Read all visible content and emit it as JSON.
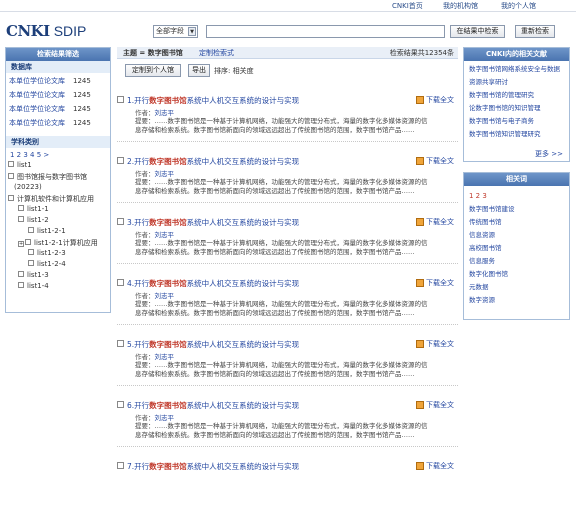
{
  "topnav": {
    "home": "CNKI首页",
    "org": "我的机构馆",
    "personal": "我的个人馆"
  },
  "logo": {
    "brand": "CNKI",
    "product": "SDIP"
  },
  "search": {
    "field": "全部字段",
    "query": "",
    "btn_in": "在结果中检索",
    "btn_re": "重新检索"
  },
  "left": {
    "title": "检索结果筛选",
    "db_head": "数据库",
    "dbs": [
      {
        "name": "本单位学位论文库",
        "count": "1245"
      },
      {
        "name": "本单位学位论文库",
        "count": "1245"
      },
      {
        "name": "本单位学位论文库",
        "count": "1245"
      },
      {
        "name": "本单位学位论文库",
        "count": "1245"
      }
    ],
    "cat_head": "学科类别",
    "pages": "1 2 3 4 5 >",
    "tree": [
      "list1",
      "图书馆报与数字图书馆",
      "(20223)",
      "计算机软件和计算机应用",
      "list1-1",
      "list1-2",
      "list1-2-1",
      "list1-2-1计算机应用",
      "list1-2-3",
      "list1-2-4",
      "list1-3",
      "list1-4"
    ]
  },
  "main": {
    "theme_label": "主题 = ",
    "theme_value": "数字图书馆",
    "custom": "定制检索式",
    "count_text": "检索结果共12354条",
    "btn_custom": "定制到个人馆",
    "btn_export": "导出",
    "sort": "排序: 相关度",
    "results": [
      {
        "num": "1.",
        "pre": "开行",
        "hl": "数字图书馆",
        "post": "系统中人机交互系统的设计与实现",
        "dl": "下载全文",
        "author_label": "作者：",
        "author": "刘志平",
        "abs1": "提要：……数字图书馆是一种基于计算机网络，功能强大的管理分布式，海量的数字化多媒体资源的信",
        "abs2": "息存储和检索系统。数字图书馆新面向的领域远远超出了传统图书馆的范围，数字图书馆产品……"
      },
      {
        "num": "2.",
        "pre": "开行",
        "hl": "数字图书馆",
        "post": "系统中人机交互系统的设计与实现",
        "dl": "下载全文",
        "author_label": "作者：",
        "author": "刘志平",
        "abs1": "提要：……数字图书馆是一种基于计算机网络，功能强大的管理分布式，海量的数字化多媒体资源的信",
        "abs2": "息存储和检索系统。数字图书馆新面向的领域远远超出了传统图书馆的范围，数字图书馆产品……"
      },
      {
        "num": "3.",
        "pre": "开行",
        "hl": "数字图书馆",
        "post": "系统中人机交互系统的设计与实现",
        "dl": "下载全文",
        "author_label": "作者：",
        "author": "刘志平",
        "abs1": "提要：……数字图书馆是一种基于计算机网络，功能强大的管理分布式，海量的数字化多媒体资源的信",
        "abs2": "息存储和检索系统。数字图书馆新面向的领域远远超出了传统图书馆的范围，数字图书馆产品……"
      },
      {
        "num": "4.",
        "pre": "开行",
        "hl": "数字图书馆",
        "post": "系统中人机交互系统的设计与实现",
        "dl": "下载全文",
        "author_label": "作者：",
        "author": "刘志平",
        "abs1": "提要：……数字图书馆是一种基于计算机网络，功能强大的管理分布式，海量的数字化多媒体资源的信",
        "abs2": "息存储和检索系统。数字图书馆新面向的领域远远超出了传统图书馆的范围，数字图书馆产品……"
      },
      {
        "num": "5.",
        "pre": "开行",
        "hl": "数字图书馆",
        "post": "系统中人机交互系统的设计与实现",
        "dl": "下载全文",
        "author_label": "作者：",
        "author": "刘志平",
        "abs1": "提要：……数字图书馆是一种基于计算机网络，功能强大的管理分布式，海量的数字化多媒体资源的信",
        "abs2": "息存储和检索系统。数字图书馆新面向的领域远远超出了传统图书馆的范围，数字图书馆产品……"
      },
      {
        "num": "6.",
        "pre": "开行",
        "hl": "数字图书馆",
        "post": "系统中人机交互系统的设计与实现",
        "dl": "下载全文",
        "author_label": "作者：",
        "author": "刘志平",
        "abs1": "提要：……数字图书馆是一种基于计算机网络，功能强大的管理分布式，海量的数字化多媒体资源的信",
        "abs2": "息存储和检索系统。数字图书馆新面向的领域远远超出了传统图书馆的范围，数字图书馆产品……"
      },
      {
        "num": "7.",
        "pre": "开行",
        "hl": "数字图书馆",
        "post": "系统中人机交互系统的设计与实现",
        "dl": "下载全文",
        "author_label": "",
        "author": "",
        "abs1": "",
        "abs2": ""
      }
    ]
  },
  "right": {
    "docs_head": "CNKI内的相关文献",
    "docs": [
      "数字图书馆网络系统安全与数据",
      "资源共享研讨",
      "数字图书馆的管理研究",
      "论数字图书馆的知识管理",
      "数字图书馆与电子商务",
      "数字图书馆知识管理研究"
    ],
    "more": "更多 >>",
    "words_head": "相关词",
    "wpages": "1 2 3",
    "words": [
      "数字图书馆建设",
      "传统图书馆",
      "信息资源",
      "高校图书馆",
      "信息服务",
      "数字化图书馆",
      "元数据",
      "数字资源"
    ]
  },
  "colors": {
    "accent": "#4a74b0",
    "link": "#2447a0",
    "highlight": "#c0392b"
  }
}
